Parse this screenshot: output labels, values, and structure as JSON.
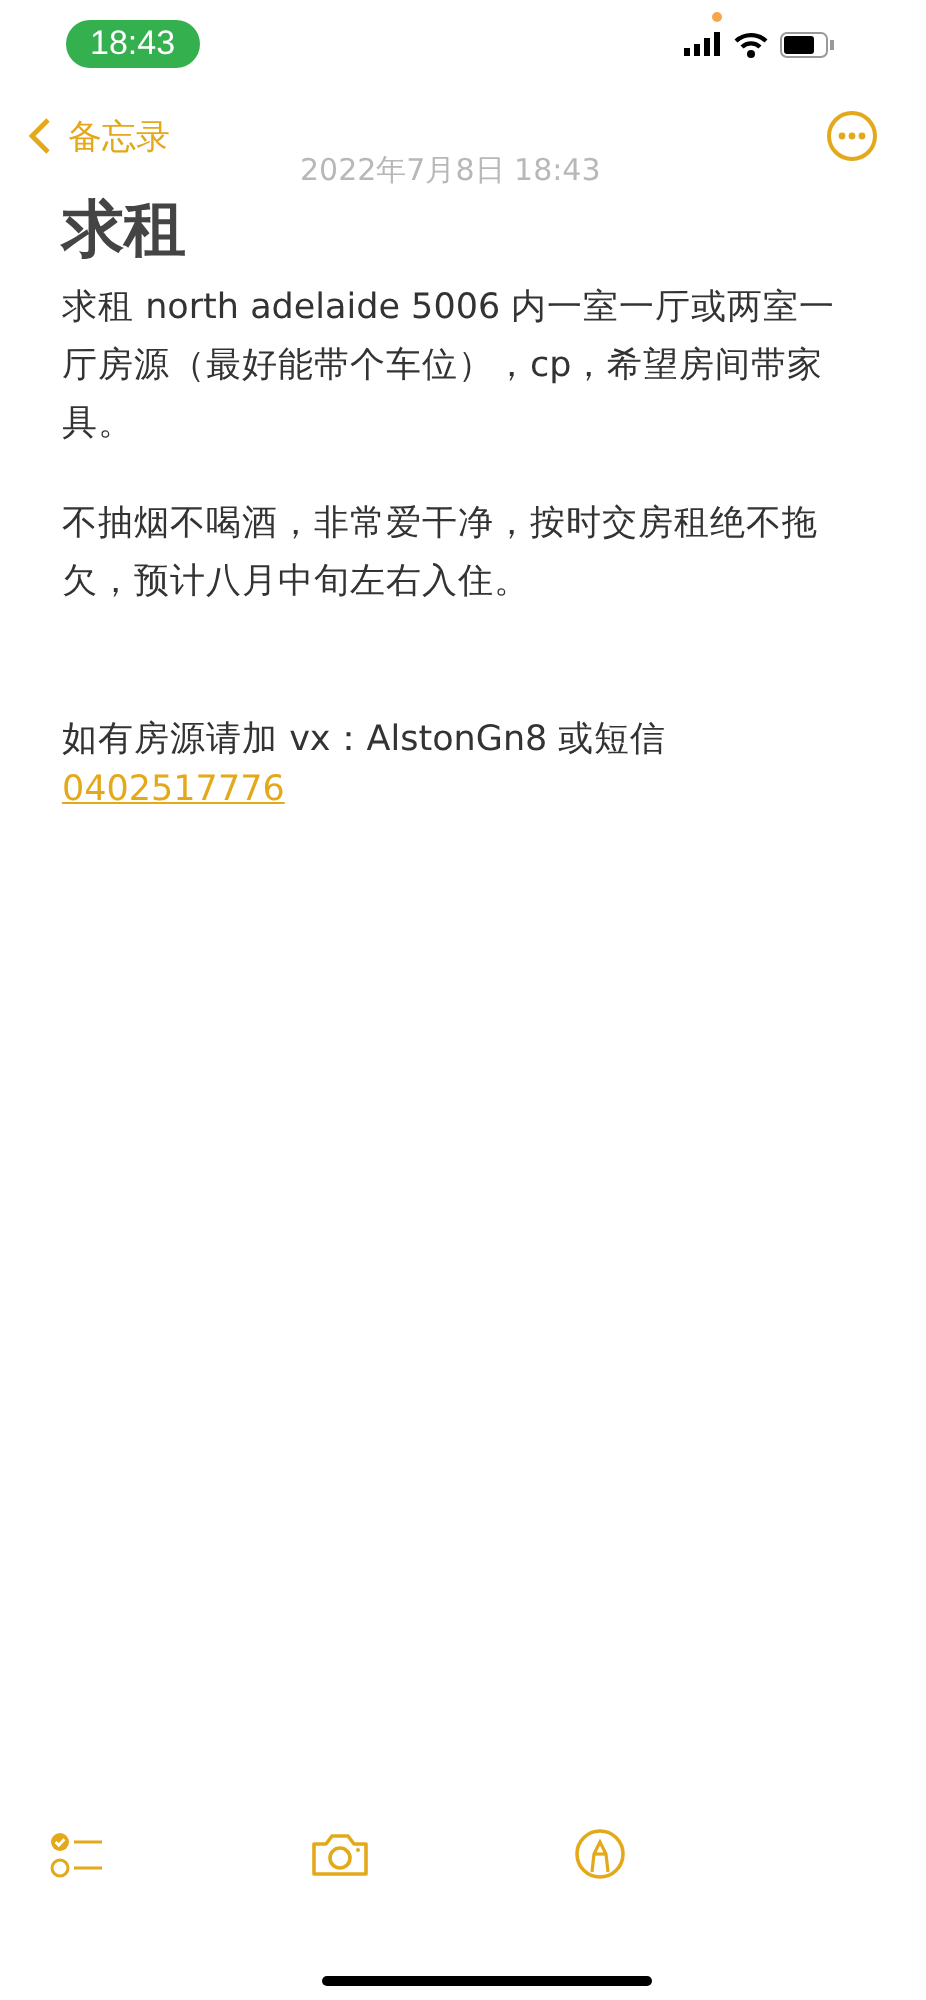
{
  "status_bar": {
    "time": "18:43"
  },
  "nav": {
    "back_label": "备忘录",
    "date": "2022年7月8日 18:43"
  },
  "note": {
    "title": "求租",
    "paragraphs": [
      {
        "kind": "text",
        "text": "求租 north adelaide 5006 内一室一厅或两室一厅房源（最好能带个车位），cp，希望房间带家具。"
      },
      {
        "kind": "text",
        "text": "不抽烟不喝酒，非常爱干净，按时交房租绝不拖欠，预计八月中旬左右入住。"
      },
      {
        "kind": "contact",
        "text": "如有房源请加 vx：AlstonGn8 或短信",
        "link": "0402517776"
      }
    ]
  }
}
